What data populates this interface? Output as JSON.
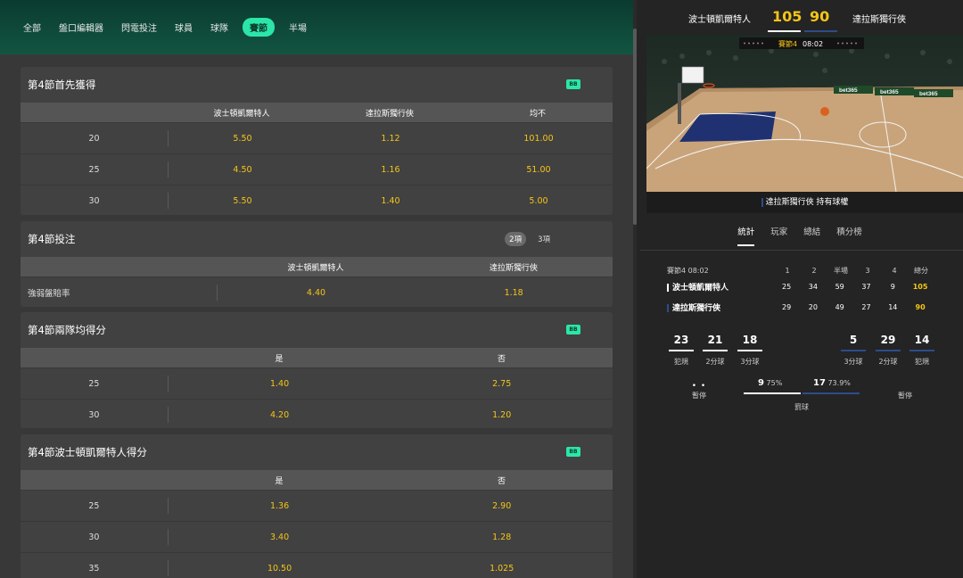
{
  "nav": {
    "tabs": [
      "全部",
      "盤口編輯器",
      "閃電投注",
      "球員",
      "球隊",
      "賽節",
      "半場"
    ],
    "active_index": 5
  },
  "markets": {
    "first_to_score": {
      "title": "第4節首先獲得",
      "badge": "BB",
      "columns": [
        "波士頓凱爾特人",
        "達拉斯獨行俠",
        "均不"
      ],
      "rows": [
        {
          "label": "20",
          "odds": [
            "5.50",
            "1.12",
            "101.00"
          ]
        },
        {
          "label": "25",
          "odds": [
            "4.50",
            "1.16",
            "51.00"
          ]
        },
        {
          "label": "30",
          "odds": [
            "5.50",
            "1.40",
            "5.00"
          ]
        }
      ]
    },
    "quarter_bet": {
      "title": "第4節投注",
      "seg_tabs": [
        "2項",
        "3項"
      ],
      "columns": [
        "波士頓凱爾特人",
        "達拉斯獨行俠"
      ],
      "rows": [
        {
          "label": "強弱盤賠率",
          "odds": [
            "4.40",
            "1.18"
          ]
        }
      ]
    },
    "both_teams": {
      "title": "第4節兩隊均得分",
      "badge": "BB",
      "columns": [
        "是",
        "否"
      ],
      "rows": [
        {
          "label": "25",
          "odds": [
            "1.40",
            "2.75"
          ]
        },
        {
          "label": "30",
          "odds": [
            "4.20",
            "1.20"
          ]
        }
      ]
    },
    "celtics_score": {
      "title": "第4節波士頓凱爾特人得分",
      "badge": "BB",
      "columns": [
        "是",
        "否"
      ],
      "rows": [
        {
          "label": "25",
          "odds": [
            "1.36",
            "2.90"
          ]
        },
        {
          "label": "30",
          "odds": [
            "3.40",
            "1.28"
          ]
        },
        {
          "label": "35",
          "odds": [
            "10.50",
            "1.025"
          ]
        }
      ]
    }
  },
  "scoreboard": {
    "home_name": "波士頓凱爾特人",
    "home_score": "105",
    "away_score": "90",
    "away_name": "達拉斯獨行俠",
    "clock_label": "賽節4",
    "clock_time": "08:02",
    "possession_text": "達拉斯獨行俠 持有球權",
    "ad_text": "bet365"
  },
  "stats_tabs": [
    "統計",
    "玩家",
    "總結",
    "積分榜"
  ],
  "box_score": {
    "period_label": "賽節4 08:02",
    "headers": [
      "1",
      "2",
      "半場",
      "3",
      "4",
      "總分"
    ],
    "teams": [
      {
        "name": "波士頓凱爾特人",
        "scores": [
          "25",
          "34",
          "59",
          "37",
          "9"
        ],
        "total": "105",
        "color": "#ffffff"
      },
      {
        "name": "達拉斯獨行俠",
        "scores": [
          "29",
          "20",
          "49",
          "27",
          "14"
        ],
        "total": "90",
        "color": "#2e4c8a"
      }
    ]
  },
  "team_stats": {
    "home": [
      {
        "value": "23",
        "label": "犯規"
      },
      {
        "value": "21",
        "label": "2分球"
      },
      {
        "value": "18",
        "label": "3分球"
      }
    ],
    "away": [
      {
        "value": "5",
        "label": "3分球"
      },
      {
        "value": "29",
        "label": "2分球"
      },
      {
        "value": "14",
        "label": "犯規"
      }
    ],
    "timeouts_label": "暫停",
    "free_throws": {
      "home_value": "9",
      "home_pct": "75%",
      "away_value": "17",
      "away_pct": "73.9%",
      "label": "罰球"
    }
  },
  "colors": {
    "accent": "#2be6a8",
    "odds": "#f5c518",
    "away": "#2e4c8a"
  }
}
